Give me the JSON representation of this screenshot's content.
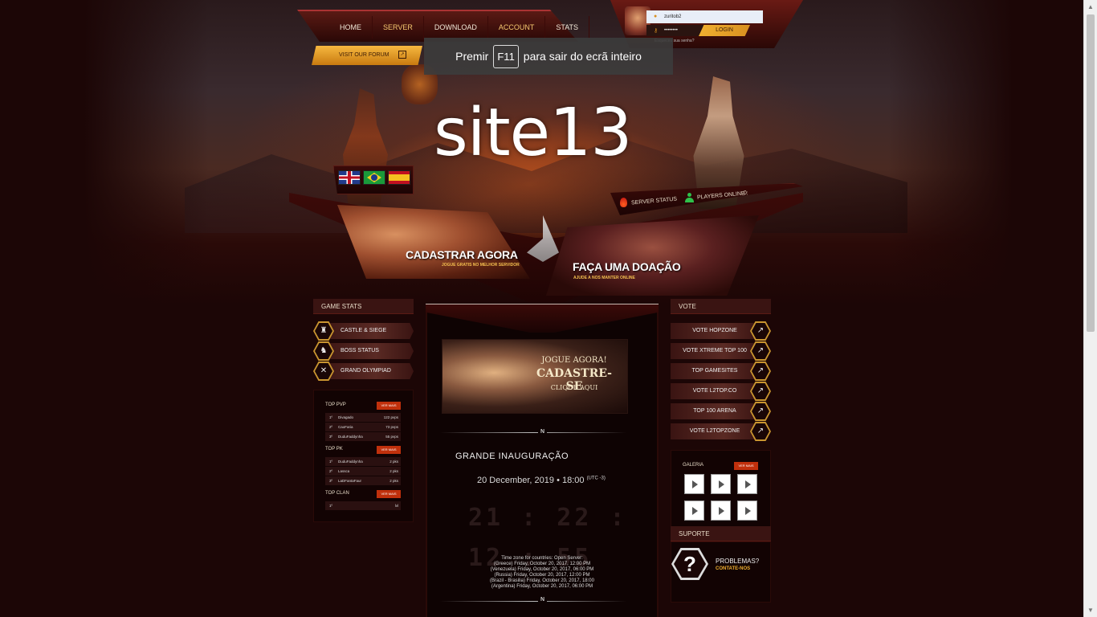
{
  "nav": {
    "items": [
      "HOME",
      "SERVER",
      "DOWNLOAD",
      "ACCOUNT",
      "STATS"
    ],
    "forum_label": "VISIT OUR FORUM"
  },
  "fullscreen_notice": {
    "prefix": "Premir",
    "key": "F11",
    "suffix": "para sair do ecrã inteiro"
  },
  "login": {
    "username_value": "zuritob2",
    "password_value": "••••••••",
    "button_label": "LOGIN",
    "forgot_text": "Esqueceu sua senha?"
  },
  "site": {
    "title": "site13"
  },
  "server": {
    "status_label": "SERVER STATUS",
    "players_label": "PLAYERS ONLINE :",
    "players_count": "0"
  },
  "banners": {
    "register_title": "CADASTRAR AGORA",
    "register_sub": "JOGUE GRATIS NO MELHOR SERVIDOR",
    "donate_title": "FAÇA UMA DOAÇÃO",
    "donate_sub": "AJUDE A NOS MANTER ONLINE"
  },
  "left_panel": {
    "header": "GAME STATS",
    "buttons": [
      {
        "label": "CASTLE & SIEGE",
        "icon": "castle-icon"
      },
      {
        "label": "BOSS STATUS",
        "icon": "dragon-icon"
      },
      {
        "label": "GRAND OLYMPIAD",
        "icon": "crossed-swords-icon"
      }
    ]
  },
  "rankings": {
    "more_label": "VER MAIS",
    "pvp": {
      "title": "TOP PVP",
      "rows": [
        {
          "rank": "1º",
          "name": "Divagado",
          "value": "122 pvps"
        },
        {
          "rank": "2º",
          "name": "CaoFaria",
          "value": "73 pvps"
        },
        {
          "rank": "3º",
          "name": "DuduFaddynha",
          "value": "55 pvps"
        }
      ]
    },
    "pk": {
      "title": "TOP PK",
      "rows": [
        {
          "rank": "1º",
          "name": "DuduFaddynha",
          "value": "2 pks"
        },
        {
          "rank": "2º",
          "name": "Lassca",
          "value": "2 pks"
        },
        {
          "rank": "3º",
          "name": "LaDFantaFaur",
          "value": "2 pks"
        }
      ]
    },
    "clan": {
      "title": "TOP CLAN",
      "rows": [
        {
          "rank": "1º",
          "name": "",
          "value": "lvl"
        }
      ]
    }
  },
  "center": {
    "promo_line1": "JOGUE AGORA!",
    "promo_line2": "CADASTRE-SE",
    "promo_line3": "CLIQUE AQUI",
    "divider_glyph": "N",
    "news_title": "GRANDE INAUGURAÇÃO",
    "news_date": "20 December, 2019 • 18:00",
    "news_date_suffix": "(UTC -3)",
    "countdown": "21 : 22 : 12 : 55",
    "tz_lines": [
      "Time zone for countries: Open Server:",
      "(Greece) Friday, October 20, 2017, 12:00 PM",
      "(Venezuela) Friday, October 20, 2017, 06:00 PM",
      "(Russia) Friday, October 20, 2017, 12:00 PM",
      "(Brazil - Brasilia) Friday, October 20, 2017, 18:00",
      "(Argentina) Friday, October 20, 2017, 06:00 PM"
    ]
  },
  "right_panel": {
    "header": "VOTE",
    "votes": [
      "VOTE HOPZONE",
      "VOTE XTREME TOP 100",
      "TOP GAMESITES",
      "VOTE L2TOP.CO",
      "TOP 100 ARENA",
      "VOTE L2TOPZONE"
    ],
    "gallery_title": "GALERIA",
    "gallery_more": "VER MAIS",
    "support_header": "SUPORTE",
    "support_title": "PROBLEMAS?",
    "support_link": "CONTATE-NOS",
    "support_glyph": "?"
  },
  "colors": {
    "background": "#1c0606",
    "accent_gold": "#f0b030",
    "accent_red": "#c0300c",
    "online_green": "#2ec04a"
  }
}
